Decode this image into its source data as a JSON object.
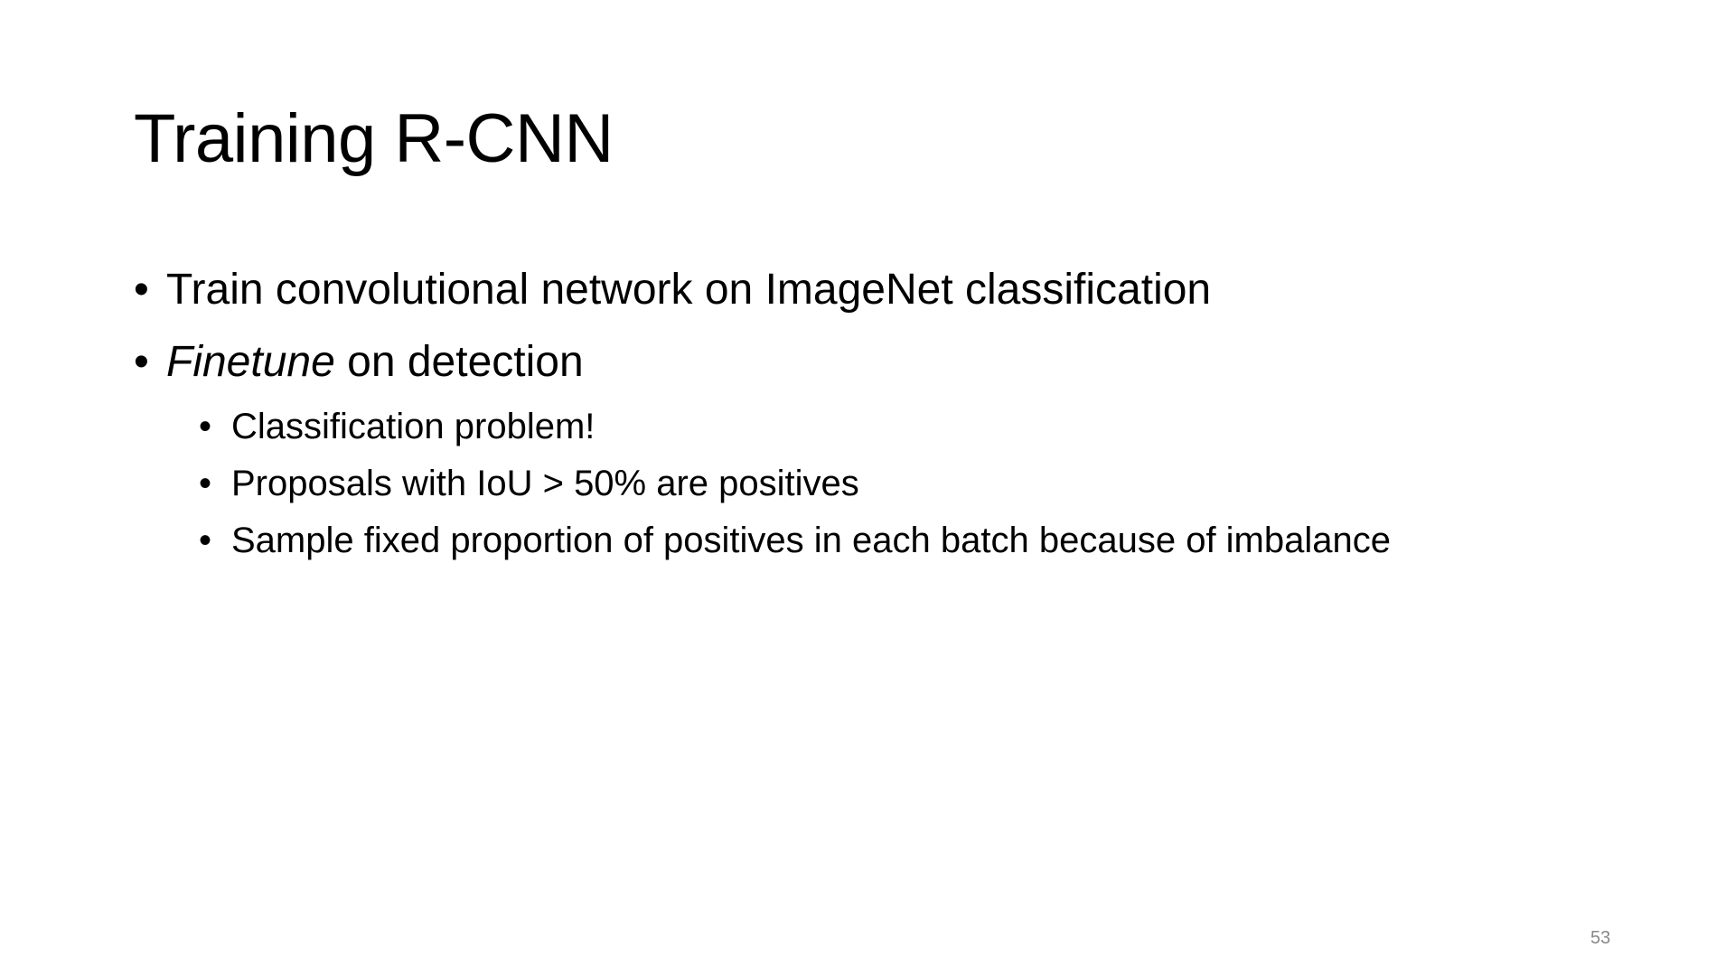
{
  "slide": {
    "title": "Training R-CNN",
    "bullets": [
      {
        "text": "Train convolutional network on ImageNet classification"
      },
      {
        "emphasis": "Finetune",
        "text": " on detection",
        "sub_bullets": [
          "Classification problem!",
          "Proposals with IoU > 50% are positives",
          "Sample fixed proportion of positives in each batch because of imbalance"
        ]
      }
    ],
    "bullet_glyph": "•",
    "page_number": "53"
  },
  "colors": {
    "background": "#ffffff",
    "text": "#000000",
    "page_number": "#898989"
  }
}
